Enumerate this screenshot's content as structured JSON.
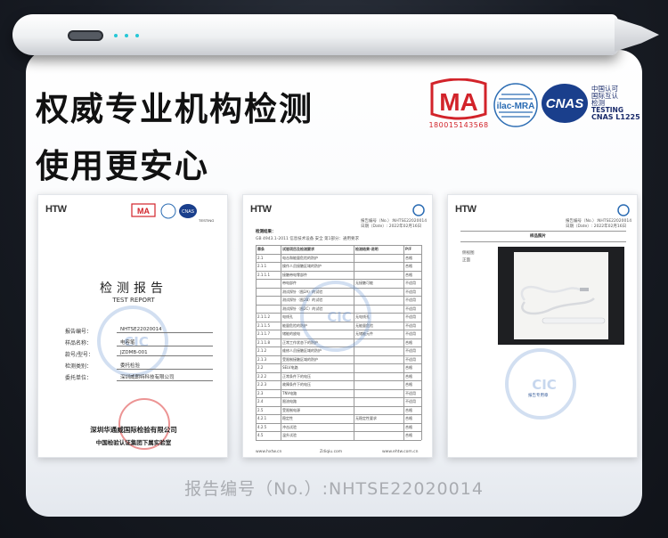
{
  "headline": {
    "line1": "权威专业机构检测",
    "line2": "使用更安心"
  },
  "logos": {
    "ma_label": "MA",
    "ma_number": "180015143568",
    "ilac_label": "ilac-MRA",
    "cnas_label": "CNAS",
    "cnas_cn": [
      "中国认可",
      "国际互认",
      "检测"
    ],
    "cnas_testing": "TESTING",
    "cnas_code": "CNAS L1225"
  },
  "reports": {
    "htw_logo": "HTW",
    "watermark": "CIC",
    "page1": {
      "title": "检测报告",
      "subtitle": "TEST REPORT",
      "rows": [
        {
          "label": "报告编号：",
          "value": "NHTSE22020014"
        },
        {
          "label": "样品名称：",
          "value": "电容笔"
        },
        {
          "label": "款号/型号：",
          "value": "JZDMB-001"
        },
        {
          "label": "检测类别：",
          "value": "委托检验"
        },
        {
          "label": "委托单位：",
          "value": "深圳威朗特科技有限公司"
        }
      ],
      "org_cn": "深圳华通威国际检验有限公司",
      "org_sub": "中国检验认证集团下属实验室",
      "mini_testing": "TESTING"
    },
    "page2": {
      "report_no": "报告编号（No.）:NHTSE22020014",
      "date": "日期（Date）: 2022年02月16日",
      "section": "检测结果：",
      "std": "GB 4943.1-2011 信息技术设备 安全 第1部分：通用要求",
      "headers": [
        "章条",
        "试验项目及检测要求",
        "检测结果-说明",
        "P/F"
      ],
      "rows": [
        [
          "2.1",
          "电击和能量危险的防护",
          "",
          "合格"
        ],
        [
          "2.1.1",
          "操作人员接触区域的防护",
          "",
          "合格"
        ],
        [
          "2.1.1.1",
          "接触带电零部件",
          "",
          "合格"
        ],
        [
          "",
          "带电部件",
          "无接触可能",
          "不适用"
        ],
        [
          "",
          "测试探针（图2A）的试验",
          "",
          "不适用"
        ],
        [
          "",
          "测试探针（图2B）的试验",
          "",
          "不适用"
        ],
        [
          "",
          "测试探针（图2C）的试验",
          "",
          "不适用"
        ],
        [
          "2.1.1.2",
          "电线孔",
          "无电线孔",
          "不适用"
        ],
        [
          "2.1.1.5",
          "能量危险的防护",
          "无能量危险",
          "不适用"
        ],
        [
          "2.1.1.7",
          "储能的放电",
          "无储能元件",
          "不适用"
        ],
        [
          "2.1.1.8",
          "正常工作状态下的防护",
          "",
          "合格"
        ],
        [
          "2.1.2",
          "维修人员接触区域的防护",
          "",
          "不适用"
        ],
        [
          "2.1.3",
          "受限制接触区域的防护",
          "",
          "不适用"
        ],
        [
          "2.2",
          "SELV电路",
          "",
          "合格"
        ],
        [
          "2.2.2",
          "正常条件下的电压",
          "",
          "合格"
        ],
        [
          "2.2.3",
          "故障条件下的电压",
          "",
          "合格"
        ],
        [
          "2.3",
          "TNV电路",
          "",
          "不适用"
        ],
        [
          "2.4",
          "限流电路",
          "",
          "不适用"
        ],
        [
          "2.5",
          "受限制电源",
          "",
          "合格"
        ],
        [
          "4.2.1",
          "稳定性",
          "无稳定性要求",
          "合格"
        ],
        [
          "4.2.5",
          "冲击试验",
          "",
          "合格"
        ],
        [
          "4.5",
          "温升试验",
          "",
          "合格"
        ]
      ],
      "footer_left": "www.hxtw.cn",
      "footer_mid": "Zdiqiu.com",
      "footer_right": "www.ehtw.com.cn"
    },
    "page3": {
      "report_no": "报告编号（No.）:NHTSE22020014",
      "date": "日期（Date）: 2022年02月16日",
      "section": "样品照片",
      "side_labels": [
        "侧视图",
        "正面"
      ],
      "stamp": "报告专用章"
    }
  },
  "caption": "报告编号（No.）:NHTSE22020014",
  "colors": {
    "ma_red": "#d2232a",
    "cnas_blue": "#1a2c6b",
    "watermark": "#5f8ccd",
    "caption": "#a9acb1"
  }
}
